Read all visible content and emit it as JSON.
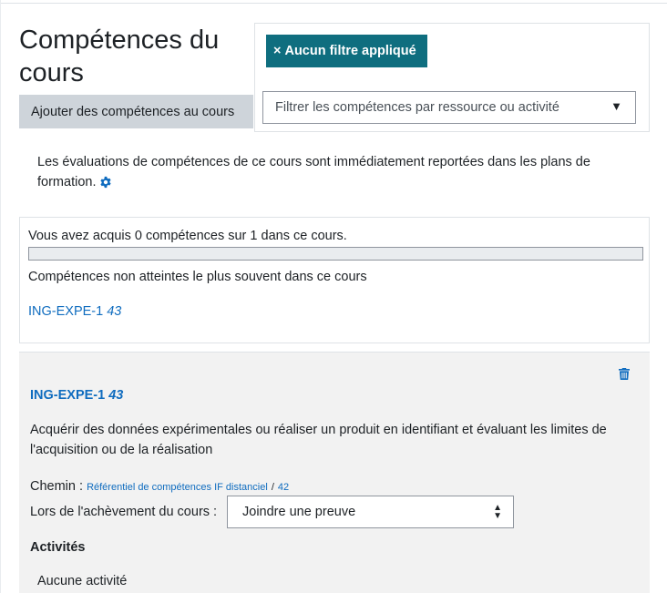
{
  "header": {
    "title": "Compétences du cours",
    "add_button_label": "Ajouter des compétences au cours"
  },
  "filter": {
    "no_filter_label": "Aucun filtre appliqué",
    "no_filter_prefix": "×",
    "select_placeholder": "Filtrer les compétences par ressource ou activité"
  },
  "info": {
    "text": "Les évaluations de compétences de ce cours sont immédiatement reportées dans les plans de formation."
  },
  "summary": {
    "acquired_text": "Vous avez acquis 0 compétences sur 1 dans ce cours.",
    "progress_fraction": 0,
    "unmet_heading": "Compétences non atteintes le plus souvent dans ce cours",
    "unmet_link_code": "ING-EXPE-1",
    "unmet_link_num": "43"
  },
  "competency": {
    "code": "ING-EXPE-1",
    "num": "43",
    "description": "Acquérir des données expérimentales ou réaliser un produit en identifiant et évaluant les limites de l'acquisition ou de la réalisation",
    "path_label": "Chemin :",
    "path_framework": "Référentiel de compétences IF distanciel",
    "path_sep": "/",
    "path_id": "42",
    "completion_label": "Lors de l'achèvement du cours :",
    "completion_value": "Joindre une preuve",
    "activities_heading": "Activités",
    "no_activity": "Aucune activité"
  },
  "colors": {
    "accent": "#0f6e7f",
    "link": "#0f6cbf",
    "card_bg": "#f2f2f2"
  },
  "icons": [
    "gear-icon",
    "trash-icon",
    "close-icon",
    "caret-down-icon",
    "sort-icon"
  ]
}
